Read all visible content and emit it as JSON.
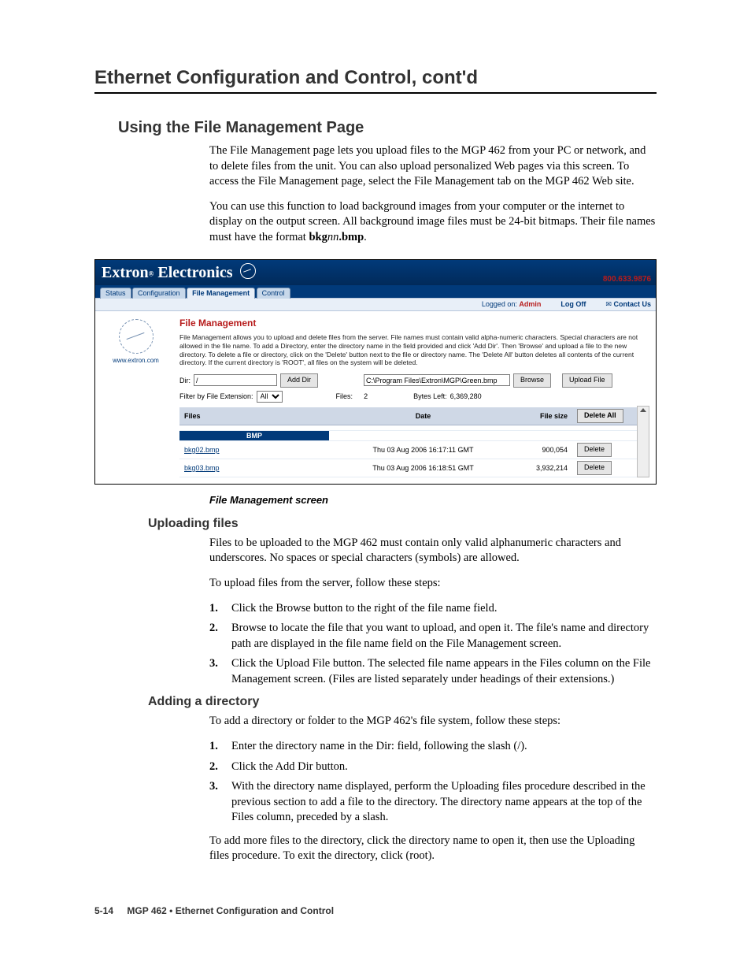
{
  "chapter": "Ethernet Configuration and Control, cont'd",
  "section1_title": "Using the File Management Page",
  "section1_p1": "The File Management page lets you upload files to the MGP 462 from your PC or network, and to delete files from the unit.  You can also upload personalized Web pages via this screen.  To access the File Management page, select the File Management tab on the MGP 462 Web site.",
  "section1_p2_a": "You can use this function to load background images from your computer or the internet to display on the output screen.  All background image files must be 24-bit bitmaps.  Their file names must have the format ",
  "section1_p2_b": "bkg",
  "section1_p2_c": "nn",
  "section1_p2_d": ".bmp",
  "section1_p2_e": ".",
  "shot": {
    "brand_a": "Extron",
    "brand_b": " Electronics",
    "tabs": [
      "Status",
      "Configuration",
      "File Management",
      "Control"
    ],
    "phone": "800.633.9876",
    "logged": "Logged on: ",
    "admin": "Admin",
    "logoff": "Log Off",
    "contact": "Contact Us",
    "sidebar_url": "www.extron.com",
    "heading": "File Management",
    "note": "File Management allows you to upload and delete files from the server. File names must contain valid alpha-numeric characters. Special characters are not allowed in the file name. To add a Directory, enter the directory name in the field provided and click 'Add Dir'. Then 'Browse' and upload a file to the new directory. To delete a file or directory, click on the 'Delete' button next to the file or directory name. The 'Delete All' button deletes all contents of the current directory. If the current directory is 'ROOT', all files on the system will be deleted.",
    "dir_label": "Dir:",
    "dir_value": "/",
    "add_dir": "Add Dir",
    "path_value": "C:\\Program Files\\Extron\\MGP\\Green.bmp",
    "browse": "Browse",
    "upload": "Upload File",
    "filter_label": "Filter by File Extension:",
    "filter_value": "All",
    "files_label": "Files:",
    "files_count": "2",
    "bytes_label": "Bytes Left:",
    "bytes_value": "6,369,280",
    "th_files": "Files",
    "th_date": "Date",
    "th_size": "File size",
    "delete_all": "Delete All",
    "group": "BMP",
    "rows": [
      {
        "name": "bkg02.bmp",
        "date": "Thu 03 Aug 2006 16:17:11 GMT",
        "size": "900,054",
        "del": "Delete"
      },
      {
        "name": "bkg03.bmp",
        "date": "Thu 03 Aug 2006 16:18:51 GMT",
        "size": "3,932,214",
        "del": "Delete"
      }
    ]
  },
  "caption": "File Management screen",
  "sub1": "Uploading files",
  "sub1_p1": "Files to be uploaded to the MGP 462 must contain only valid alphanumeric characters and underscores.  No spaces or special characters (symbols) are allowed.",
  "sub1_p2": "To upload files from the server, follow these steps:",
  "sub1_steps": [
    "Click the Browse button to the right of the file name field.",
    "Browse to locate the file that you want to upload, and open it.  The file's name and directory path are displayed in the file name field on the File Management screen.",
    "Click the Upload File button.  The selected file name appears in the Files column on the File Management screen.  (Files are listed separately under headings of their extensions.)"
  ],
  "sub2": "Adding a directory",
  "sub2_p1": "To add a directory or folder to the MGP 462's file system, follow these steps:",
  "sub2_steps": [
    "Enter the directory name in the Dir: field, following the slash (/).",
    "Click the Add Dir button.",
    "With the directory name displayed, perform the Uploading files procedure described in the previous section to add a file to the directory.  The directory name appears at the top of the Files column, preceded by a slash."
  ],
  "sub2_p2": "To add more files to the directory, click the directory name to open it, then use the Uploading files procedure.  To exit the directory, click (root).",
  "footer_page": "5-14",
  "footer_text": "MGP 462 • Ethernet Configuration and Control"
}
